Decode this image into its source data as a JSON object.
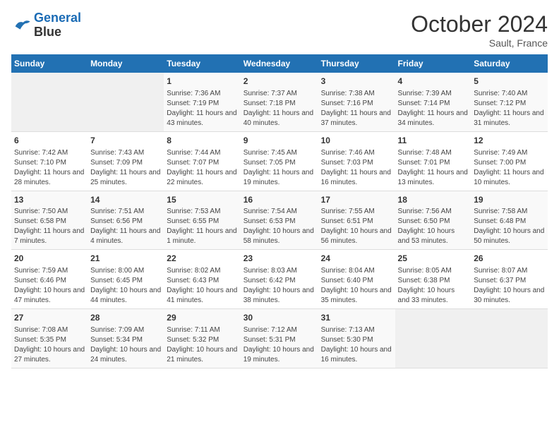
{
  "header": {
    "logo_line1": "General",
    "logo_line2": "Blue",
    "month": "October 2024",
    "location": "Sault, France"
  },
  "days_of_week": [
    "Sunday",
    "Monday",
    "Tuesday",
    "Wednesday",
    "Thursday",
    "Friday",
    "Saturday"
  ],
  "weeks": [
    [
      {
        "day": null
      },
      {
        "day": null
      },
      {
        "day": "1",
        "sunrise": "Sunrise: 7:36 AM",
        "sunset": "Sunset: 7:19 PM",
        "daylight": "Daylight: 11 hours and 43 minutes."
      },
      {
        "day": "2",
        "sunrise": "Sunrise: 7:37 AM",
        "sunset": "Sunset: 7:18 PM",
        "daylight": "Daylight: 11 hours and 40 minutes."
      },
      {
        "day": "3",
        "sunrise": "Sunrise: 7:38 AM",
        "sunset": "Sunset: 7:16 PM",
        "daylight": "Daylight: 11 hours and 37 minutes."
      },
      {
        "day": "4",
        "sunrise": "Sunrise: 7:39 AM",
        "sunset": "Sunset: 7:14 PM",
        "daylight": "Daylight: 11 hours and 34 minutes."
      },
      {
        "day": "5",
        "sunrise": "Sunrise: 7:40 AM",
        "sunset": "Sunset: 7:12 PM",
        "daylight": "Daylight: 11 hours and 31 minutes."
      }
    ],
    [
      {
        "day": "6",
        "sunrise": "Sunrise: 7:42 AM",
        "sunset": "Sunset: 7:10 PM",
        "daylight": "Daylight: 11 hours and 28 minutes."
      },
      {
        "day": "7",
        "sunrise": "Sunrise: 7:43 AM",
        "sunset": "Sunset: 7:09 PM",
        "daylight": "Daylight: 11 hours and 25 minutes."
      },
      {
        "day": "8",
        "sunrise": "Sunrise: 7:44 AM",
        "sunset": "Sunset: 7:07 PM",
        "daylight": "Daylight: 11 hours and 22 minutes."
      },
      {
        "day": "9",
        "sunrise": "Sunrise: 7:45 AM",
        "sunset": "Sunset: 7:05 PM",
        "daylight": "Daylight: 11 hours and 19 minutes."
      },
      {
        "day": "10",
        "sunrise": "Sunrise: 7:46 AM",
        "sunset": "Sunset: 7:03 PM",
        "daylight": "Daylight: 11 hours and 16 minutes."
      },
      {
        "day": "11",
        "sunrise": "Sunrise: 7:48 AM",
        "sunset": "Sunset: 7:01 PM",
        "daylight": "Daylight: 11 hours and 13 minutes."
      },
      {
        "day": "12",
        "sunrise": "Sunrise: 7:49 AM",
        "sunset": "Sunset: 7:00 PM",
        "daylight": "Daylight: 11 hours and 10 minutes."
      }
    ],
    [
      {
        "day": "13",
        "sunrise": "Sunrise: 7:50 AM",
        "sunset": "Sunset: 6:58 PM",
        "daylight": "Daylight: 11 hours and 7 minutes."
      },
      {
        "day": "14",
        "sunrise": "Sunrise: 7:51 AM",
        "sunset": "Sunset: 6:56 PM",
        "daylight": "Daylight: 11 hours and 4 minutes."
      },
      {
        "day": "15",
        "sunrise": "Sunrise: 7:53 AM",
        "sunset": "Sunset: 6:55 PM",
        "daylight": "Daylight: 11 hours and 1 minute."
      },
      {
        "day": "16",
        "sunrise": "Sunrise: 7:54 AM",
        "sunset": "Sunset: 6:53 PM",
        "daylight": "Daylight: 10 hours and 58 minutes."
      },
      {
        "day": "17",
        "sunrise": "Sunrise: 7:55 AM",
        "sunset": "Sunset: 6:51 PM",
        "daylight": "Daylight: 10 hours and 56 minutes."
      },
      {
        "day": "18",
        "sunrise": "Sunrise: 7:56 AM",
        "sunset": "Sunset: 6:50 PM",
        "daylight": "Daylight: 10 hours and 53 minutes."
      },
      {
        "day": "19",
        "sunrise": "Sunrise: 7:58 AM",
        "sunset": "Sunset: 6:48 PM",
        "daylight": "Daylight: 10 hours and 50 minutes."
      }
    ],
    [
      {
        "day": "20",
        "sunrise": "Sunrise: 7:59 AM",
        "sunset": "Sunset: 6:46 PM",
        "daylight": "Daylight: 10 hours and 47 minutes."
      },
      {
        "day": "21",
        "sunrise": "Sunrise: 8:00 AM",
        "sunset": "Sunset: 6:45 PM",
        "daylight": "Daylight: 10 hours and 44 minutes."
      },
      {
        "day": "22",
        "sunrise": "Sunrise: 8:02 AM",
        "sunset": "Sunset: 6:43 PM",
        "daylight": "Daylight: 10 hours and 41 minutes."
      },
      {
        "day": "23",
        "sunrise": "Sunrise: 8:03 AM",
        "sunset": "Sunset: 6:42 PM",
        "daylight": "Daylight: 10 hours and 38 minutes."
      },
      {
        "day": "24",
        "sunrise": "Sunrise: 8:04 AM",
        "sunset": "Sunset: 6:40 PM",
        "daylight": "Daylight: 10 hours and 35 minutes."
      },
      {
        "day": "25",
        "sunrise": "Sunrise: 8:05 AM",
        "sunset": "Sunset: 6:38 PM",
        "daylight": "Daylight: 10 hours and 33 minutes."
      },
      {
        "day": "26",
        "sunrise": "Sunrise: 8:07 AM",
        "sunset": "Sunset: 6:37 PM",
        "daylight": "Daylight: 10 hours and 30 minutes."
      }
    ],
    [
      {
        "day": "27",
        "sunrise": "Sunrise: 7:08 AM",
        "sunset": "Sunset: 5:35 PM",
        "daylight": "Daylight: 10 hours and 27 minutes."
      },
      {
        "day": "28",
        "sunrise": "Sunrise: 7:09 AM",
        "sunset": "Sunset: 5:34 PM",
        "daylight": "Daylight: 10 hours and 24 minutes."
      },
      {
        "day": "29",
        "sunrise": "Sunrise: 7:11 AM",
        "sunset": "Sunset: 5:32 PM",
        "daylight": "Daylight: 10 hours and 21 minutes."
      },
      {
        "day": "30",
        "sunrise": "Sunrise: 7:12 AM",
        "sunset": "Sunset: 5:31 PM",
        "daylight": "Daylight: 10 hours and 19 minutes."
      },
      {
        "day": "31",
        "sunrise": "Sunrise: 7:13 AM",
        "sunset": "Sunset: 5:30 PM",
        "daylight": "Daylight: 10 hours and 16 minutes."
      },
      {
        "day": null
      },
      {
        "day": null
      }
    ]
  ]
}
